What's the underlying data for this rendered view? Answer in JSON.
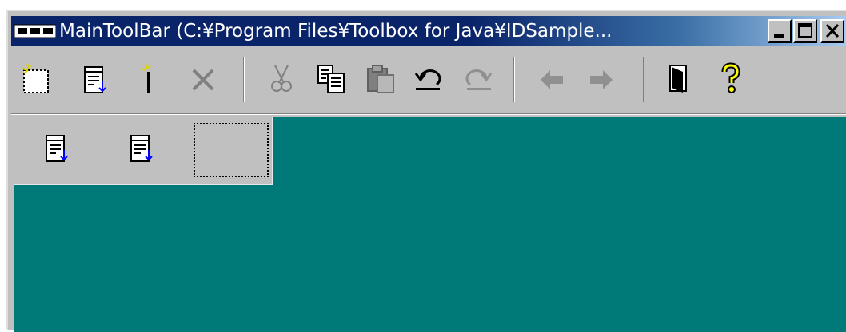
{
  "window": {
    "title": "MainToolBar (C:¥Program Files¥Toolbox for Java¥IDSample...",
    "app_icon": "toolbar-app-icon",
    "caption_buttons": [
      "minimize-icon",
      "maximize-icon",
      "close-icon"
    ]
  },
  "toolbar": {
    "groups": [
      [
        "new-icon",
        "open-icon",
        "new-item-icon",
        "delete-icon"
      ],
      [
        "cut-icon",
        "copy-icon",
        "paste-icon",
        "undo-icon",
        "redo-icon"
      ],
      [
        "back-arrow-icon",
        "forward-arrow-icon"
      ],
      [
        "exit-icon",
        "help-icon"
      ]
    ]
  },
  "panel": {
    "items": [
      "document-refresh-icon",
      "document-refresh-icon"
    ],
    "empty_slot": "dotted-placeholder"
  },
  "colors": {
    "titlebar_start": "#0a246a",
    "titlebar_end": "#a6caf0",
    "face": "#c0c0c0",
    "client": "#007a78"
  }
}
